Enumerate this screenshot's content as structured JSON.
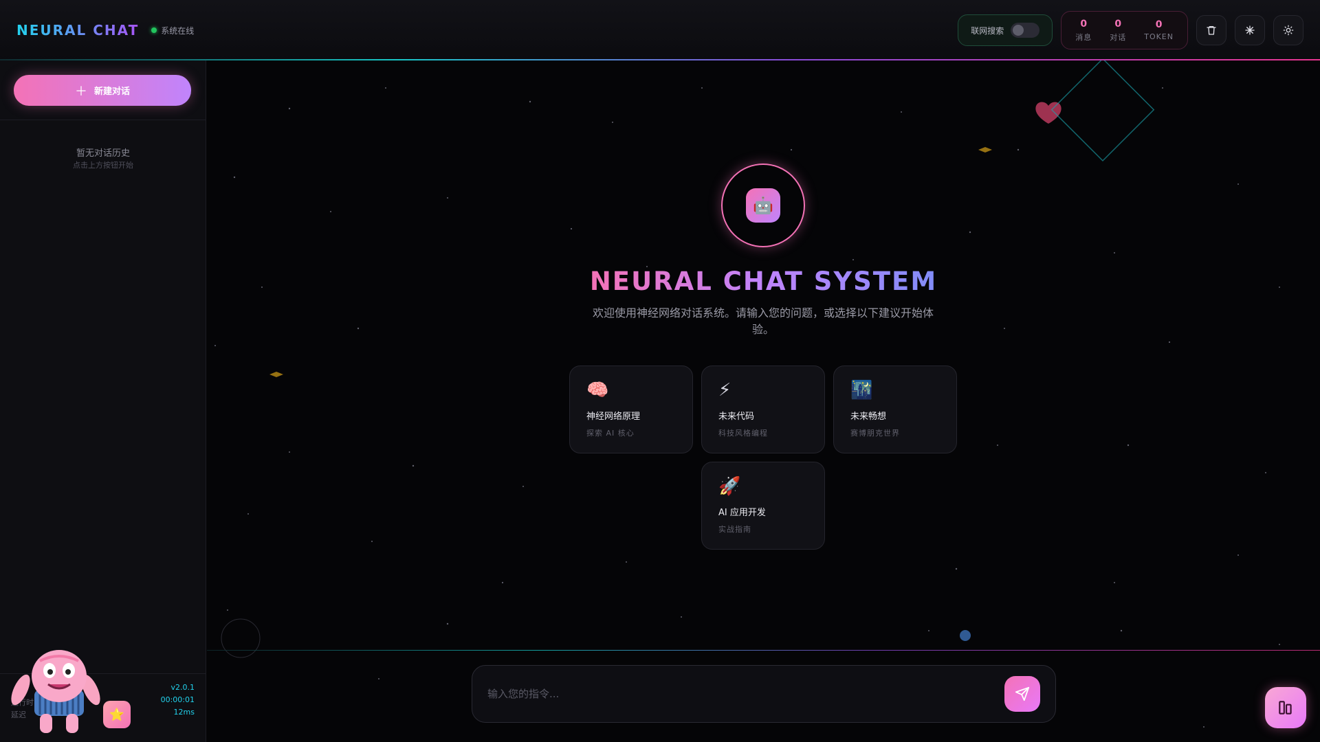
{
  "header": {
    "brand": "NEURAL CHAT",
    "status": "系统在线",
    "web_search_label": "联网搜索",
    "web_search_enabled": false,
    "stats": [
      {
        "value": "0",
        "label": "消息"
      },
      {
        "value": "0",
        "label": "对话"
      },
      {
        "value": "0",
        "label": "TOKEN"
      }
    ],
    "buttons": [
      "trash-icon",
      "sparkle-icon",
      "sun-icon"
    ]
  },
  "sidebar": {
    "new_chat_label": "新建对话",
    "empty_title": "暂无对话历史",
    "empty_sub": "点击上方按钮开始",
    "footer": {
      "version": "v2.0.1",
      "runtime_label": "运行时",
      "runtime": "00:00:01",
      "latency_label": "延迟",
      "latency": "12ms"
    }
  },
  "main": {
    "title": "NEURAL CHAT SYSTEM",
    "subtitle": "欢迎使用神经网络对话系统。请输入您的问题，或选择以下建议开始体验。",
    "suggestions": [
      {
        "emoji": "🧠",
        "title": "神经网络原理",
        "sub": "探索 AI 核心"
      },
      {
        "emoji": "⚡",
        "title": "未来代码",
        "sub": "科技风格编程"
      },
      {
        "emoji": "🌃",
        "title": "未来畅想",
        "sub": "赛博朋克世界"
      },
      {
        "emoji": "🚀",
        "title": "AI 应用开发",
        "sub": "实战指南"
      }
    ],
    "input_placeholder": "输入您的指令..."
  },
  "colors": {
    "accent_pink": "#f472b6",
    "accent_purple": "#c084fc",
    "accent_cyan": "#22d3ee",
    "online": "#22c55e"
  }
}
